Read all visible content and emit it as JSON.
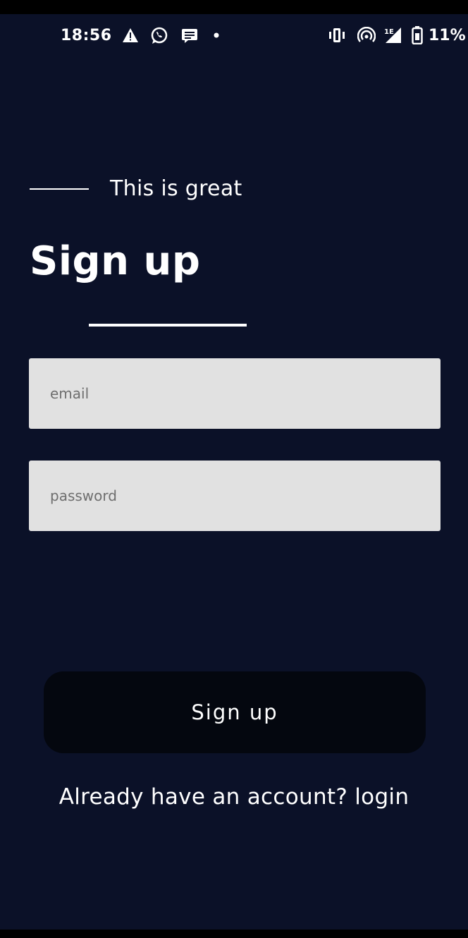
{
  "status_bar": {
    "time": "18:56",
    "battery_percent": "11%",
    "icons": [
      "warning-icon",
      "whatsapp-icon",
      "message-icon",
      "dot-icon",
      "vibrate-icon",
      "hotspot-icon",
      "signal-icon",
      "battery-icon"
    ]
  },
  "header": {
    "tagline": "This is great",
    "title": "Sign up"
  },
  "form": {
    "email_placeholder": "email",
    "email_value": "",
    "password_placeholder": "password",
    "password_value": ""
  },
  "actions": {
    "signup_label": "Sign up",
    "login_prompt": "Already have an account?",
    "login_link": "login"
  },
  "colors": {
    "background": "#0b1128",
    "field_background": "#e1e1e1",
    "button_background": "#04070f",
    "text": "#ffffff"
  }
}
